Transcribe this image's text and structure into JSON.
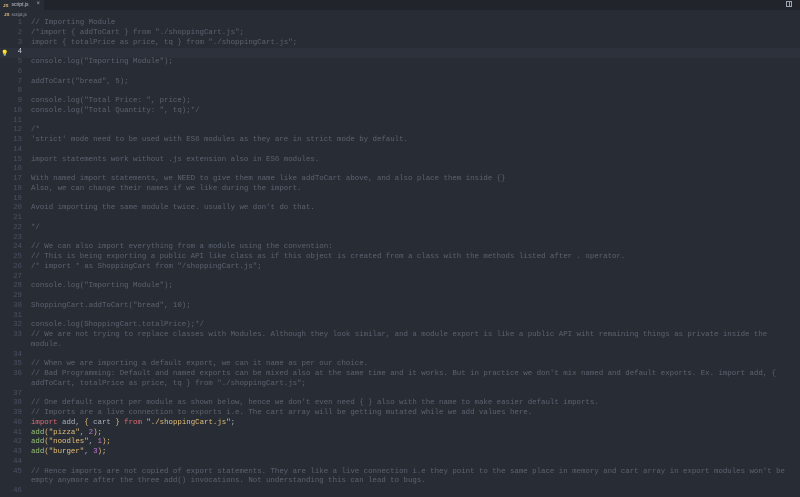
{
  "tab": {
    "icon": "JS",
    "label": "script.js",
    "close": "×"
  },
  "breadcrumb": {
    "icon": "JS",
    "label": "script.js"
  },
  "current_line": 4,
  "lines": [
    {
      "n": "1",
      "parts": [
        {
          "t": "// Importing Module",
          "c": "cm"
        }
      ]
    },
    {
      "n": "2",
      "parts": [
        {
          "t": "/*import { addToCart } from \"./shoppingCart.js\";",
          "c": "cm"
        }
      ]
    },
    {
      "n": "3",
      "parts": [
        {
          "t": "import { totalPrice as price, tq } from \"./shoppingCart.js\";",
          "c": "cm"
        }
      ]
    },
    {
      "n": "4",
      "parts": [
        {
          "t": "",
          "c": "cm"
        }
      ]
    },
    {
      "n": "5",
      "parts": [
        {
          "t": "console.log(\"Importing Module\");",
          "c": "cm"
        }
      ]
    },
    {
      "n": "6",
      "parts": [
        {
          "t": "",
          "c": "cm"
        }
      ]
    },
    {
      "n": "7",
      "parts": [
        {
          "t": "addToCart(\"bread\", 5);",
          "c": "cm"
        }
      ]
    },
    {
      "n": "8",
      "parts": [
        {
          "t": "",
          "c": "cm"
        }
      ]
    },
    {
      "n": "9",
      "parts": [
        {
          "t": "console.log(\"Total Price: \", price);",
          "c": "cm"
        }
      ]
    },
    {
      "n": "10",
      "parts": [
        {
          "t": "console.log(\"Total Quantity: \", tq);*/",
          "c": "cm"
        }
      ]
    },
    {
      "n": "11",
      "parts": [
        {
          "t": "",
          "c": "cm"
        }
      ]
    },
    {
      "n": "12",
      "parts": [
        {
          "t": "/*",
          "c": "cm"
        }
      ]
    },
    {
      "n": "13",
      "parts": [
        {
          "t": "'strict' mode need to be used with ES6 modules as they are in strict mode by default.",
          "c": "cm"
        }
      ]
    },
    {
      "n": "14",
      "parts": [
        {
          "t": "",
          "c": "cm"
        }
      ]
    },
    {
      "n": "15",
      "parts": [
        {
          "t": "import statements work without .js extension also in ES6 modules.",
          "c": "cm"
        }
      ]
    },
    {
      "n": "16",
      "parts": [
        {
          "t": "",
          "c": "cm"
        }
      ]
    },
    {
      "n": "17",
      "parts": [
        {
          "t": "With named import statements, we NEED to give them name like addToCart above, and also place them inside {}",
          "c": "cm"
        }
      ]
    },
    {
      "n": "18",
      "parts": [
        {
          "t": "Also, we can change their names if we like during the import.",
          "c": "cm"
        }
      ]
    },
    {
      "n": "19",
      "parts": [
        {
          "t": "",
          "c": "cm"
        }
      ]
    },
    {
      "n": "20",
      "parts": [
        {
          "t": "Avoid importing the same module twice. usually we don't do that.",
          "c": "cm"
        }
      ]
    },
    {
      "n": "21",
      "parts": [
        {
          "t": "",
          "c": "cm"
        }
      ]
    },
    {
      "n": "22",
      "parts": [
        {
          "t": "*/",
          "c": "cm"
        }
      ]
    },
    {
      "n": "23",
      "parts": [
        {
          "t": "",
          "c": "cm"
        }
      ]
    },
    {
      "n": "24",
      "parts": [
        {
          "t": "// We can also import everything from a module using the convention:",
          "c": "cm"
        }
      ]
    },
    {
      "n": "25",
      "parts": [
        {
          "t": "// This is being exporting a public API like class as if this object is created from a class with the methods listed after . operator.",
          "c": "cm"
        }
      ]
    },
    {
      "n": "26",
      "parts": [
        {
          "t": "/* import * as ShoppingCart from \"/shoppingCart.js\";",
          "c": "cm"
        }
      ]
    },
    {
      "n": "27",
      "parts": [
        {
          "t": "",
          "c": "cm"
        }
      ]
    },
    {
      "n": "28",
      "parts": [
        {
          "t": "console.log(\"Importing Module\");",
          "c": "cm"
        }
      ]
    },
    {
      "n": "29",
      "parts": [
        {
          "t": "",
          "c": "cm"
        }
      ]
    },
    {
      "n": "30",
      "parts": [
        {
          "t": "ShoppingCart.addToCart(\"bread\", 10);",
          "c": "cm"
        }
      ]
    },
    {
      "n": "31",
      "parts": [
        {
          "t": "",
          "c": "cm"
        }
      ]
    },
    {
      "n": "32",
      "parts": [
        {
          "t": "console.log(ShoppingCart.totalPrice);*/",
          "c": "cm"
        }
      ]
    },
    {
      "n": "33",
      "parts": [
        {
          "t": "// We are not trying to replace classes with Modules. Although they look similar, and a module export is like a public API wiht remaining things as private inside the module.",
          "c": "cm"
        }
      ]
    },
    {
      "n": "34",
      "parts": [
        {
          "t": "",
          "c": "cm"
        }
      ]
    },
    {
      "n": "35",
      "parts": [
        {
          "t": "// When we are importing a default export, we can it name as per our choice.",
          "c": "cm"
        }
      ]
    },
    {
      "n": "36",
      "parts": [
        {
          "t": "// Bad Programming: Default and named exports can be mixed also at the same time and it works. But in practice we don't mix named and default exports. Ex. import add, { addToCart, totalPrice as price, tq } from \"./shoppingCart.js\";",
          "c": "cm"
        }
      ]
    },
    {
      "n": "37",
      "parts": [
        {
          "t": "",
          "c": "cm"
        }
      ]
    },
    {
      "n": "38",
      "parts": [
        {
          "t": "// One default export per module as shown below, hence we don't even need { } also with the name to make easier default imports.",
          "c": "cm"
        }
      ]
    },
    {
      "n": "39",
      "parts": [
        {
          "t": "// Imports are a live connection to exports i.e. The cart array will be getting mutated while we add values here.",
          "c": "cm"
        }
      ]
    },
    {
      "n": "40",
      "parts": [
        {
          "t": "import",
          "c": "kw"
        },
        {
          "t": " add, ",
          "c": "pl"
        },
        {
          "t": "{",
          "c": "br"
        },
        {
          "t": " cart ",
          "c": "pl"
        },
        {
          "t": "}",
          "c": "br"
        },
        {
          "t": " from ",
          "c": "kw"
        },
        {
          "t": "\"./shoppingCart.js\"",
          "c": "str"
        },
        {
          "t": ";",
          "c": "pl"
        }
      ]
    },
    {
      "n": "41",
      "parts": [
        {
          "t": "add",
          "c": "fn"
        },
        {
          "t": "(",
          "c": "br"
        },
        {
          "t": "\"pizza\"",
          "c": "str"
        },
        {
          "t": ", ",
          "c": "pl"
        },
        {
          "t": "2",
          "c": "num"
        },
        {
          "t": ");",
          "c": "br"
        }
      ]
    },
    {
      "n": "42",
      "parts": [
        {
          "t": "add",
          "c": "fn"
        },
        {
          "t": "(",
          "c": "br"
        },
        {
          "t": "\"noodles\"",
          "c": "str"
        },
        {
          "t": ", ",
          "c": "pl"
        },
        {
          "t": "1",
          "c": "num"
        },
        {
          "t": ");",
          "c": "br"
        }
      ]
    },
    {
      "n": "43",
      "parts": [
        {
          "t": "add",
          "c": "fn"
        },
        {
          "t": "(",
          "c": "br"
        },
        {
          "t": "\"burger\"",
          "c": "str"
        },
        {
          "t": ", ",
          "c": "pl"
        },
        {
          "t": "3",
          "c": "num"
        },
        {
          "t": ");",
          "c": "br"
        }
      ]
    },
    {
      "n": "44",
      "parts": [
        {
          "t": "",
          "c": "cm"
        }
      ]
    },
    {
      "n": "45",
      "parts": [
        {
          "t": "// Hence imports are not copied of export statements. They are like a live connection i.e they point to the same place in memory and cart array in export modules won't be empty anymore after the three add() invocations. Not understanding this can lead to bugs.",
          "c": "cm"
        }
      ]
    },
    {
      "n": "46",
      "parts": [
        {
          "t": "",
          "c": "cm"
        }
      ]
    }
  ]
}
